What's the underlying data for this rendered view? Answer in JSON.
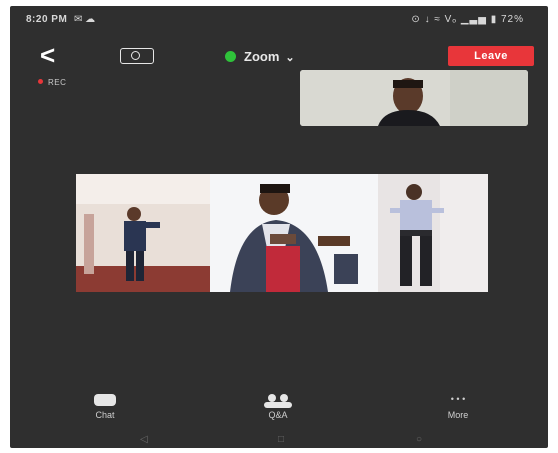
{
  "status_bar": {
    "time": "8:20 PM",
    "left_icons": "✉ ☁",
    "right_icons": "⊙ ↓ ≈ Vₒ ▁▃▅ ▮",
    "battery": "72%"
  },
  "toolbar": {
    "back_glyph": "<",
    "meeting_title": "Zoom",
    "title_chevron": "⌄",
    "leave_label": "Leave"
  },
  "recording": {
    "label": "REC"
  },
  "bottom_tabs": [
    {
      "icon": "chat-icon",
      "label": "Chat"
    },
    {
      "icon": "participants-icon",
      "label": "Q&A"
    },
    {
      "icon": "more-icon",
      "label": "More"
    }
  ],
  "more_glyph": "• • •",
  "nav": {
    "back": "◁",
    "home": "□",
    "recents": "○"
  },
  "colors": {
    "background": "#2f2f2f",
    "leave_red": "#e8363a",
    "secure_green": "#2fc23a",
    "text": "#e8e8e8"
  }
}
